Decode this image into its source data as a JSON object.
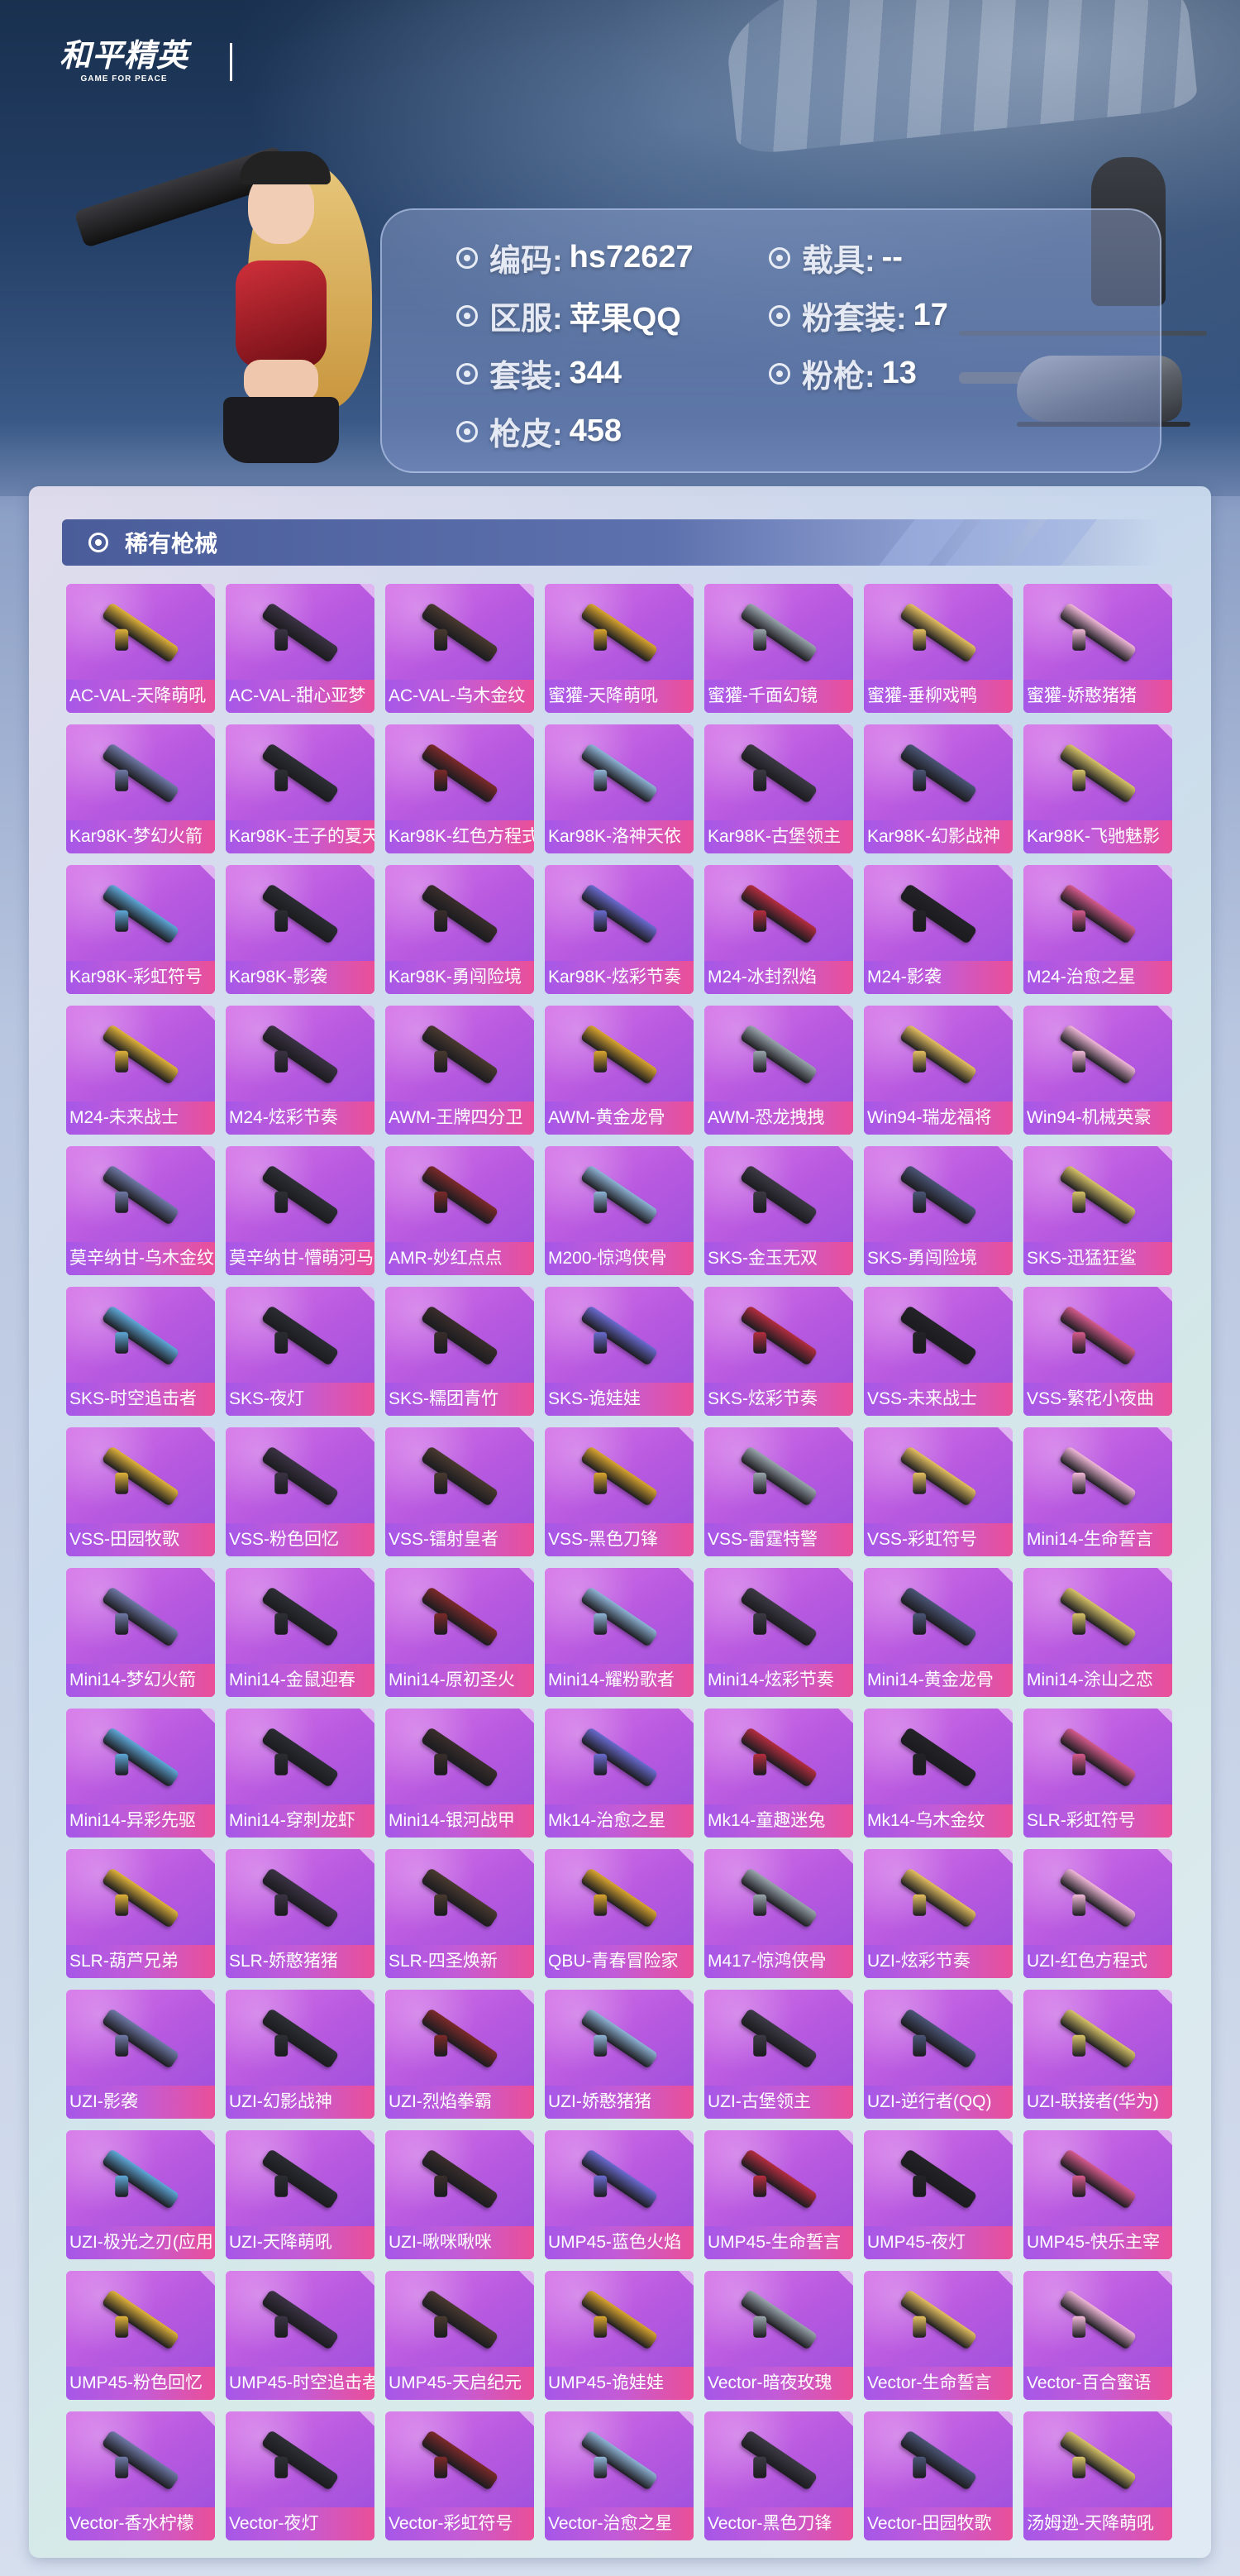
{
  "header": {
    "logo_cn": "和平精英",
    "logo_en": "GAME FOR PEACE"
  },
  "account": {
    "code_label": "编码:",
    "code_value": "hs72627",
    "vehicle_label": "载具:",
    "vehicle_value": "--",
    "server_label": "区服:",
    "server_value": "苹果QQ",
    "pink_suit_label": "粉套装:",
    "pink_suit_value": "17",
    "suit_label": "套装:",
    "suit_value": "344",
    "pink_gun_label": "粉枪:",
    "pink_gun_value": "13",
    "gun_skin_label": "枪皮:",
    "gun_skin_value": "458"
  },
  "section": {
    "title": "稀有枪械"
  },
  "weapons": [
    "AC-VAL-天降萌吼",
    "AC-VAL-甜心亚梦",
    "AC-VAL-乌木金纹",
    "蜜獾-天降萌吼",
    "蜜獾-千面幻镜",
    "蜜獾-垂柳戏鸭",
    "蜜獾-娇憨猪猪",
    "Kar98K-梦幻火箭",
    "Kar98K-王子的夏天",
    "Kar98K-红色方程式",
    "Kar98K-洛神天依",
    "Kar98K-古堡领主",
    "Kar98K-幻影战神",
    "Kar98K-飞驰魅影",
    "Kar98K-彩虹符号",
    "Kar98K-影袭",
    "Kar98K-勇闯险境",
    "Kar98K-炫彩节奏",
    "M24-冰封烈焰",
    "M24-影袭",
    "M24-治愈之星",
    "M24-未来战士",
    "M24-炫彩节奏",
    "AWM-王牌四分卫",
    "AWM-黄金龙骨",
    "AWM-恐龙拽拽",
    "Win94-瑞龙福将",
    "Win94-机械英豪",
    "莫辛纳甘-乌木金纹",
    "莫辛纳甘-懵萌河马",
    "AMR-妙红点点",
    "M200-惊鸿侠骨",
    "SKS-金玉无双",
    "SKS-勇闯险境",
    "SKS-迅猛狂鲨",
    "SKS-时空追击者",
    "SKS-夜灯",
    "SKS-糯团青竹",
    "SKS-诡娃娃",
    "SKS-炫彩节奏",
    "VSS-未来战士",
    "VSS-繁花小夜曲",
    "VSS-田园牧歌",
    "VSS-粉色回忆",
    "VSS-镭射皇者",
    "VSS-黑色刀锋",
    "VSS-雷霆特警",
    "VSS-彩虹符号",
    "Mini14-生命誓言",
    "Mini14-梦幻火箭",
    "Mini14-金鼠迎春",
    "Mini14-原初圣火",
    "Mini14-耀粉歌者",
    "Mini14-炫彩节奏",
    "Mini14-黄金龙骨",
    "Mini14-涂山之恋",
    "Mini14-异彩先驱",
    "Mini14-穿刺龙虾",
    "Mini14-银河战甲",
    "Mk14-治愈之星",
    "Mk14-童趣迷兔",
    "Mk14-乌木金纹",
    "SLR-彩虹符号",
    "SLR-葫芦兄弟",
    "SLR-娇憨猪猪",
    "SLR-四圣焕新",
    "QBU-青春冒险家",
    "M417-惊鸿侠骨",
    "UZI-炫彩节奏",
    "UZI-红色方程式",
    "UZI-影袭",
    "UZI-幻影战神",
    "UZI-烈焰拳霸",
    "UZI-娇憨猪猪",
    "UZI-古堡领主",
    "UZI-逆行者(QQ)",
    "UZI-联接者(华为)",
    "UZI-极光之刃(应用",
    "UZI-天降萌吼",
    "UZI-啾咪啾咪",
    "UMP45-蓝色火焰",
    "UMP45-生命誓言",
    "UMP45-夜灯",
    "UMP45-快乐主宰",
    "UMP45-粉色回忆",
    "UMP45-时空追击者",
    "UMP45-天启纪元",
    "UMP45-诡娃娃",
    "Vector-暗夜玫瑰",
    "Vector-生命誓言",
    "Vector-百合蜜语",
    "Vector-香水柠檬",
    "Vector-夜灯",
    "Vector-彩虹符号",
    "Vector-治愈之星",
    "Vector-黑色刀锋",
    "Vector-田园牧歌",
    "汤姆逊-天降萌吼"
  ],
  "weapon_colors": [
    "#e0b33a",
    "#3b3344",
    "#4a3a30",
    "#d9a52f",
    "#9aa5ad",
    "#e5c060",
    "#f2b9d8",
    "#6f79a6",
    "#2e3036",
    "#7c2a2a",
    "#8fb4d6",
    "#3d3a45",
    "#4b5576",
    "#d8c468",
    "#5fa8d8",
    "#2b2d33",
    "#3a2e2c",
    "#6a6bd0",
    "#b42d3f",
    "#242428",
    "#d65a8c"
  ]
}
